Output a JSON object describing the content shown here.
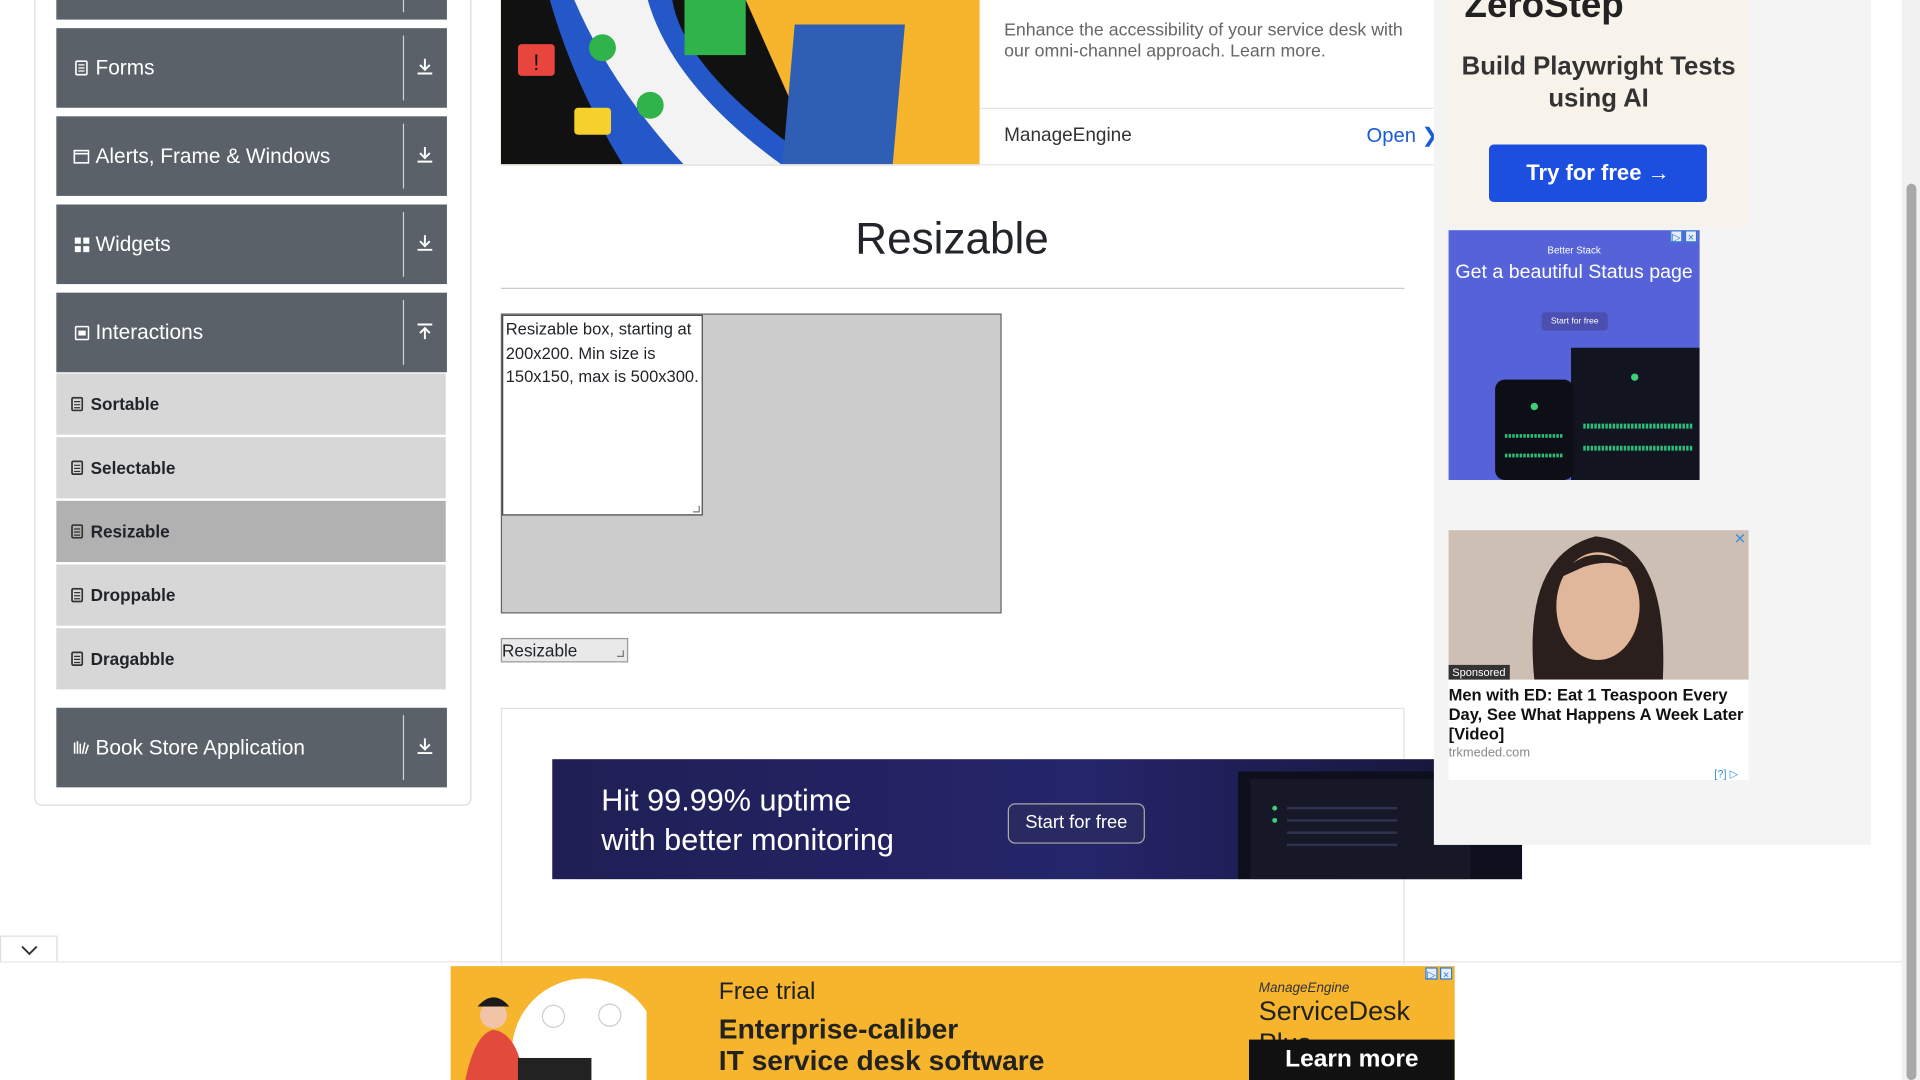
{
  "sidebar": {
    "groups": {
      "forms": {
        "label": "Forms",
        "icon": "form-icon",
        "arrow": "download-arrow-icon"
      },
      "alerts": {
        "label": "Alerts, Frame & Windows",
        "icon": "window-icon",
        "arrow": "download-arrow-icon"
      },
      "widgets": {
        "label": "Widgets",
        "icon": "grid-icon",
        "arrow": "download-arrow-icon"
      },
      "interactions": {
        "label": "Interactions",
        "icon": "interactions-icon",
        "arrow": "upload-arrow-icon"
      },
      "bookstore": {
        "label": "Book Store Application",
        "icon": "books-icon",
        "arrow": "download-arrow-icon"
      }
    },
    "items": [
      {
        "label": "Sortable",
        "active": false
      },
      {
        "label": "Selectable",
        "active": false
      },
      {
        "label": "Resizable",
        "active": true
      },
      {
        "label": "Droppable",
        "active": false
      },
      {
        "label": "Dragabble",
        "active": false
      }
    ]
  },
  "top_ad": {
    "text": "Enhance the accessibility of your service desk with our omni-channel approach. Learn more.",
    "brand": "ManageEngine",
    "open_label": "Open"
  },
  "main": {
    "title": "Resizable",
    "box_text": "Resizable box, starting at 200x200. Min size is 150x150, max is 500x300.",
    "small_box_text": "Resizable"
  },
  "banner_ad": {
    "line1": "Hit 99.99% uptime",
    "line2": "with better monitoring",
    "button": "Start for free"
  },
  "right_ads": {
    "zerostep": {
      "logo": "ZeroStep",
      "headline": "Build Playwright Tests using AI",
      "button": "Try for free →"
    },
    "betterstack": {
      "brand": "Better Stack",
      "headline": "Get a beautiful Status page",
      "button": "Start for free"
    },
    "sponsored": {
      "tag": "Sponsored",
      "title": "Men with ED: Eat 1 Teaspoon Every Day, See What Happens A Week Later [Video]",
      "domain": "trkmeded.com",
      "help": "[?]"
    }
  },
  "bottom_ad": {
    "free_trial": "Free trial",
    "line1": "Enterprise-caliber",
    "line2": "IT service desk software",
    "brand": "ManageEngine",
    "product": "ServiceDesk Plus",
    "button": "Learn more"
  },
  "colors": {
    "group_header": "#5b6168",
    "menu_item": "#d7d7d7",
    "menu_item_active": "#b1b1b1",
    "resize_container": "#cccccc",
    "ad_blue": "#1c4fe0",
    "ad_yellow": "#f6b52c"
  }
}
